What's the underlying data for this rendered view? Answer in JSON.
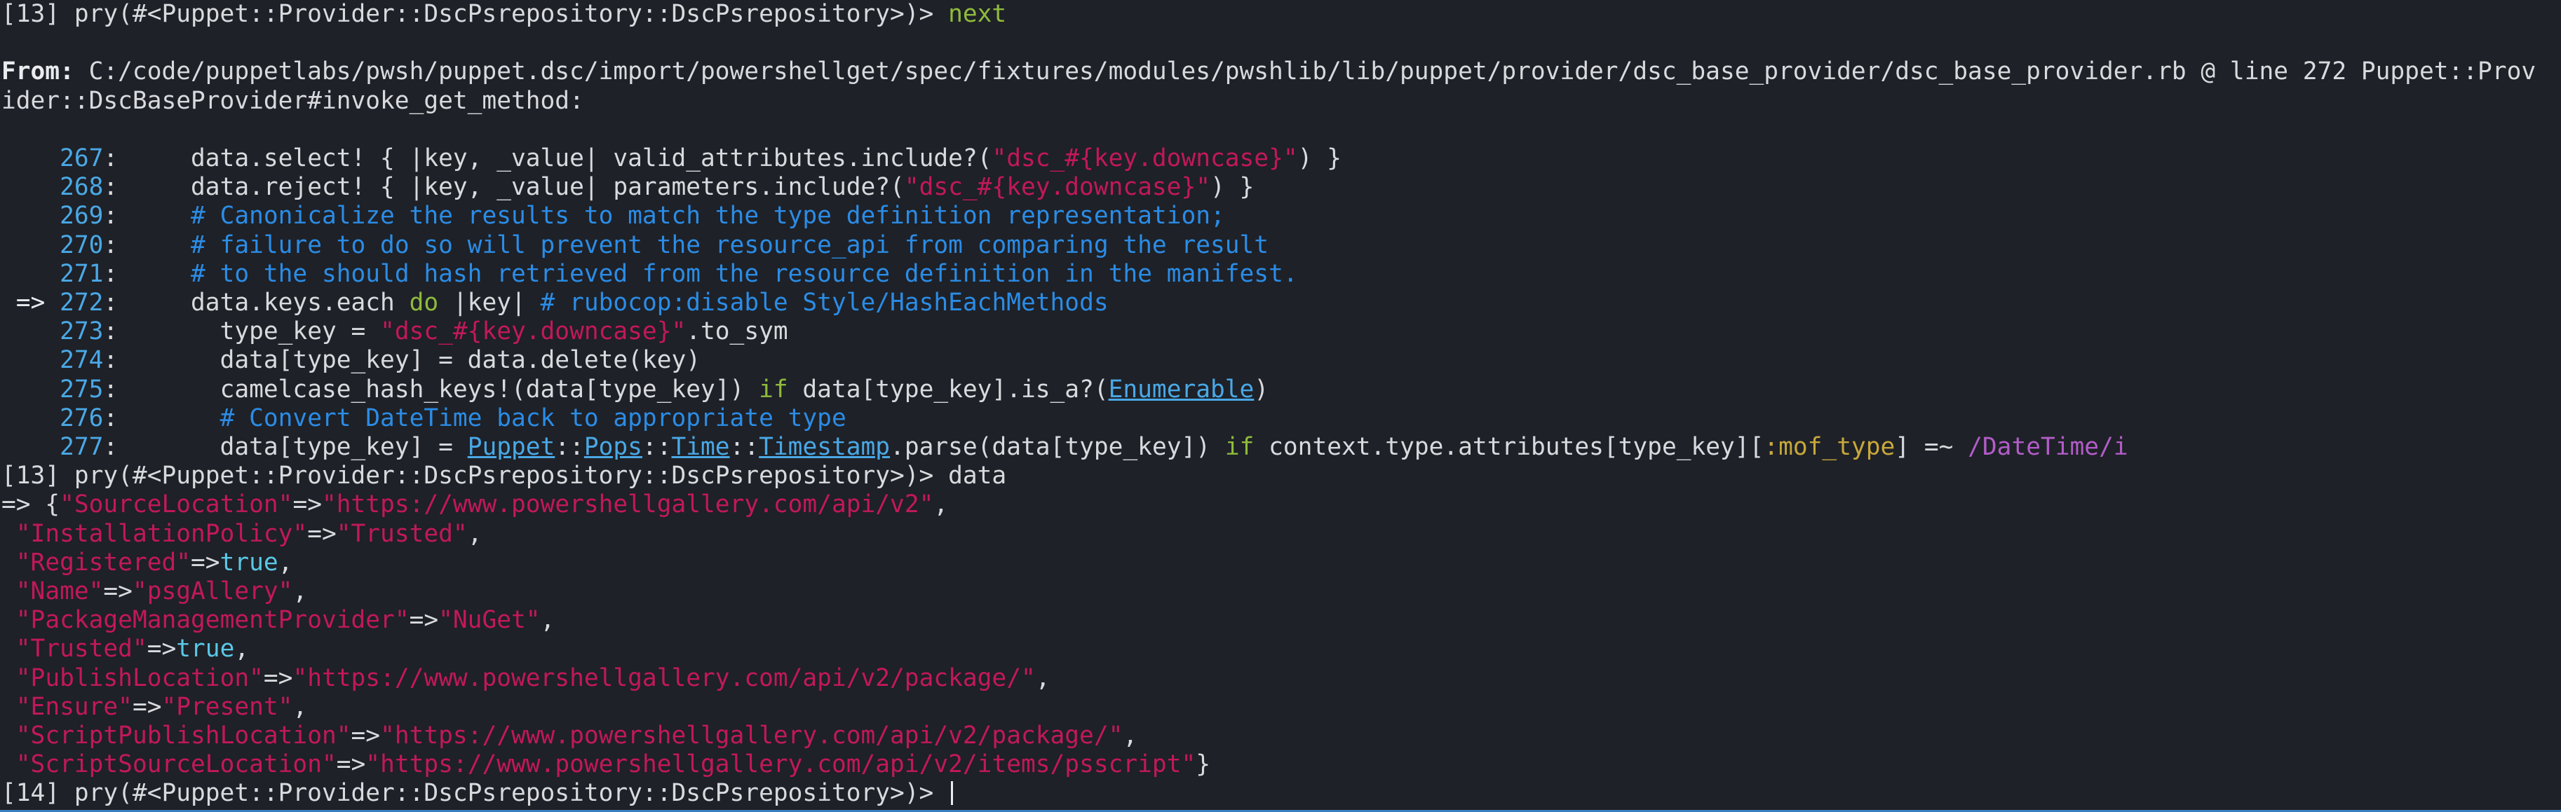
{
  "terminal": {
    "lines": [
      [
        {
          "t": "[13] pry(#<Puppet::Provider::DscPsrepository::DscPsrepository>)> ",
          "c": "text"
        },
        {
          "t": "next",
          "c": "cmd"
        }
      ],
      [],
      [
        {
          "t": "From: ",
          "c": "bold"
        },
        {
          "t": "C:/code/puppetlabs/pwsh/puppet.dsc/import/powershellget/spec/fixtures/modules/pwshlib/lib/puppet/provider/dsc_base_provider/dsc_base_provider.rb @ line 272 Puppet::Prov",
          "c": "text"
        }
      ],
      [
        {
          "t": "ider::DscBaseProvider#invoke_get_method:",
          "c": "text"
        }
      ],
      [],
      [
        {
          "t": "    267",
          "c": "ln"
        },
        {
          "t": ":     data.select! { |key, _value| valid_attributes.include?(",
          "c": "text"
        },
        {
          "t": "\"dsc_#{key.downcase}\"",
          "c": "str"
        },
        {
          "t": ") }",
          "c": "text"
        }
      ],
      [
        {
          "t": "    268",
          "c": "ln"
        },
        {
          "t": ":     data.reject! { |key, _value| parameters.include?(",
          "c": "text"
        },
        {
          "t": "\"dsc_#{key.downcase}\"",
          "c": "str"
        },
        {
          "t": ") }",
          "c": "text"
        }
      ],
      [
        {
          "t": "    269",
          "c": "ln"
        },
        {
          "t": ":     ",
          "c": "text"
        },
        {
          "t": "# Canonicalize the results to match the type definition representation;",
          "c": "cm"
        }
      ],
      [
        {
          "t": "    270",
          "c": "ln"
        },
        {
          "t": ":     ",
          "c": "text"
        },
        {
          "t": "# failure to do so will prevent the resource_api from comparing the result",
          "c": "cm"
        }
      ],
      [
        {
          "t": "    271",
          "c": "ln"
        },
        {
          "t": ":     ",
          "c": "text"
        },
        {
          "t": "# to the should hash retrieved from the resource definition in the manifest.",
          "c": "cm"
        }
      ],
      [
        {
          "t": " => ",
          "c": "arrow"
        },
        {
          "t": "272",
          "c": "ln"
        },
        {
          "t": ":     data.keys.each ",
          "c": "text"
        },
        {
          "t": "do",
          "c": "kw"
        },
        {
          "t": " |key| ",
          "c": "text"
        },
        {
          "t": "# rubocop:disable Style/HashEachMethods",
          "c": "cm"
        }
      ],
      [
        {
          "t": "    273",
          "c": "ln"
        },
        {
          "t": ":       type_key = ",
          "c": "text"
        },
        {
          "t": "\"dsc_#{key.downcase}\"",
          "c": "str"
        },
        {
          "t": ".to_sym",
          "c": "text"
        }
      ],
      [
        {
          "t": "    274",
          "c": "ln"
        },
        {
          "t": ":       data[type_key] = data.delete(key)",
          "c": "text"
        }
      ],
      [
        {
          "t": "    275",
          "c": "ln"
        },
        {
          "t": ":       camelcase_hash_keys!(data[type_key]) ",
          "c": "text"
        },
        {
          "t": "if",
          "c": "kw"
        },
        {
          "t": " data[type_key].is_a?(",
          "c": "text"
        },
        {
          "t": "Enumerable",
          "c": "cst"
        },
        {
          "t": ")",
          "c": "text"
        }
      ],
      [
        {
          "t": "    276",
          "c": "ln"
        },
        {
          "t": ":       ",
          "c": "text"
        },
        {
          "t": "# Convert DateTime back to appropriate type",
          "c": "cm"
        }
      ],
      [
        {
          "t": "    277",
          "c": "ln"
        },
        {
          "t": ":       data[type_key] = ",
          "c": "text"
        },
        {
          "t": "Puppet",
          "c": "cst"
        },
        {
          "t": "::",
          "c": "text"
        },
        {
          "t": "Pops",
          "c": "cst"
        },
        {
          "t": "::",
          "c": "text"
        },
        {
          "t": "Time",
          "c": "cst"
        },
        {
          "t": "::",
          "c": "text"
        },
        {
          "t": "Timestamp",
          "c": "cst"
        },
        {
          "t": ".parse(data[type_key]) ",
          "c": "text"
        },
        {
          "t": "if",
          "c": "kw"
        },
        {
          "t": " context.type.attributes[type_key][",
          "c": "text"
        },
        {
          "t": ":mof_type",
          "c": "sym"
        },
        {
          "t": "] =~ ",
          "c": "text"
        },
        {
          "t": "/DateTime/i",
          "c": "rx"
        }
      ],
      [
        {
          "t": "[13] pry(#<Puppet::Provider::DscPsrepository::DscPsrepository>)> data",
          "c": "text"
        }
      ],
      [
        {
          "t": "=> {",
          "c": "text"
        },
        {
          "t": "\"SourceLocation\"",
          "c": "str"
        },
        {
          "t": "=>",
          "c": "text"
        },
        {
          "t": "\"https://www.powershellgallery.com/api/v2\"",
          "c": "str"
        },
        {
          "t": ",",
          "c": "text"
        }
      ],
      [
        {
          "t": " ",
          "c": "text"
        },
        {
          "t": "\"InstallationPolicy\"",
          "c": "str"
        },
        {
          "t": "=>",
          "c": "text"
        },
        {
          "t": "\"Trusted\"",
          "c": "str"
        },
        {
          "t": ",",
          "c": "text"
        }
      ],
      [
        {
          "t": " ",
          "c": "text"
        },
        {
          "t": "\"Registered\"",
          "c": "str"
        },
        {
          "t": "=>",
          "c": "text"
        },
        {
          "t": "true",
          "c": "bool"
        },
        {
          "t": ",",
          "c": "text"
        }
      ],
      [
        {
          "t": " ",
          "c": "text"
        },
        {
          "t": "\"Name\"",
          "c": "str"
        },
        {
          "t": "=>",
          "c": "text"
        },
        {
          "t": "\"psgAllery\"",
          "c": "str"
        },
        {
          "t": ",",
          "c": "text"
        }
      ],
      [
        {
          "t": " ",
          "c": "text"
        },
        {
          "t": "\"PackageManagementProvider\"",
          "c": "str"
        },
        {
          "t": "=>",
          "c": "text"
        },
        {
          "t": "\"NuGet\"",
          "c": "str"
        },
        {
          "t": ",",
          "c": "text"
        }
      ],
      [
        {
          "t": " ",
          "c": "text"
        },
        {
          "t": "\"Trusted\"",
          "c": "str"
        },
        {
          "t": "=>",
          "c": "text"
        },
        {
          "t": "true",
          "c": "bool"
        },
        {
          "t": ",",
          "c": "text"
        }
      ],
      [
        {
          "t": " ",
          "c": "text"
        },
        {
          "t": "\"PublishLocation\"",
          "c": "str"
        },
        {
          "t": "=>",
          "c": "text"
        },
        {
          "t": "\"https://www.powershellgallery.com/api/v2/package/\"",
          "c": "str"
        },
        {
          "t": ",",
          "c": "text"
        }
      ],
      [
        {
          "t": " ",
          "c": "text"
        },
        {
          "t": "\"Ensure\"",
          "c": "str"
        },
        {
          "t": "=>",
          "c": "text"
        },
        {
          "t": "\"Present\"",
          "c": "str"
        },
        {
          "t": ",",
          "c": "text"
        }
      ],
      [
        {
          "t": " ",
          "c": "text"
        },
        {
          "t": "\"ScriptPublishLocation\"",
          "c": "str"
        },
        {
          "t": "=>",
          "c": "text"
        },
        {
          "t": "\"https://www.powershellgallery.com/api/v2/package/\"",
          "c": "str"
        },
        {
          "t": ",",
          "c": "text"
        }
      ],
      [
        {
          "t": " ",
          "c": "text"
        },
        {
          "t": "\"ScriptSourceLocation\"",
          "c": "str"
        },
        {
          "t": "=>",
          "c": "text"
        },
        {
          "t": "\"https://www.powershellgallery.com/api/v2/items/psscript\"",
          "c": "str"
        },
        {
          "t": "}",
          "c": "text"
        }
      ],
      [
        {
          "t": "[14] pry(#<Puppet::Provider::DscPsrepository::DscPsrepository>)> ",
          "c": "text"
        }
      ]
    ]
  },
  "colors": {
    "background": "#1e2127",
    "text": "#d8dade",
    "string": "#c2185b",
    "comment": "#2b8ce6",
    "keyword": "#8fbb3c",
    "line_number": "#4aa8e6",
    "symbol": "#c8a83a",
    "boolean": "#5ac8e6",
    "regex": "#b25cc8"
  }
}
